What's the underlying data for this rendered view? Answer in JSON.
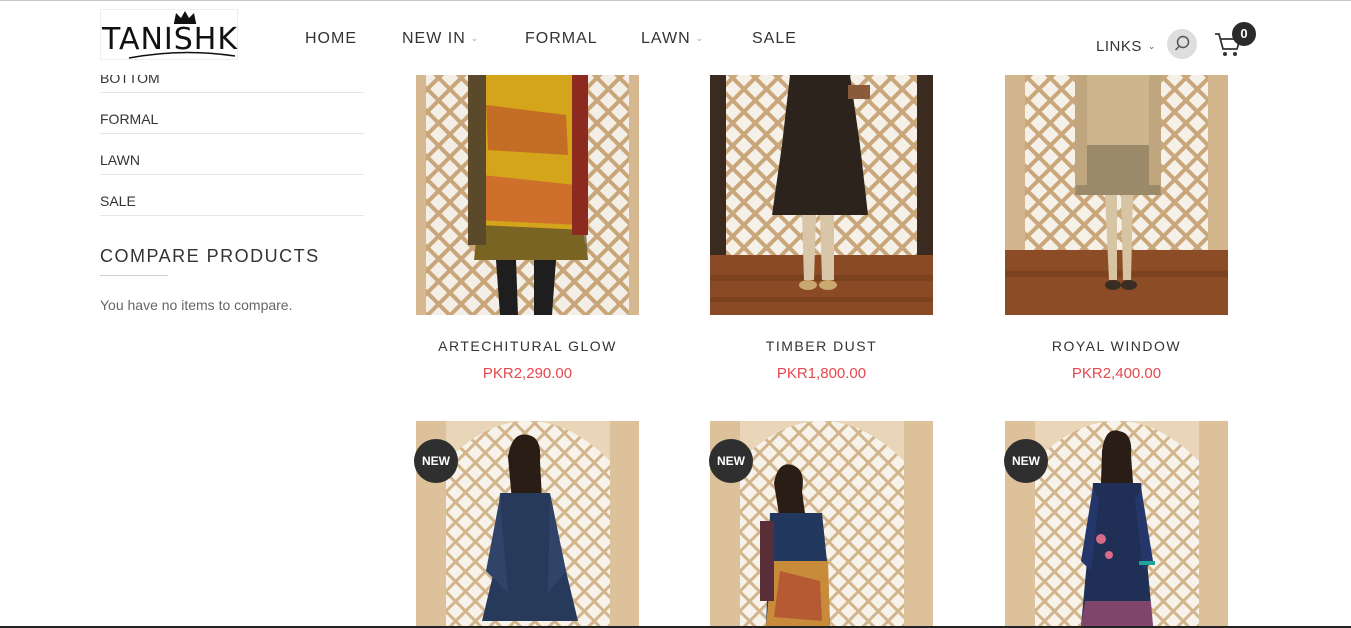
{
  "brand": {
    "logo_text": "TANISHK"
  },
  "nav": {
    "items": [
      {
        "label": "HOME",
        "has_dropdown": false
      },
      {
        "label": "NEW IN",
        "has_dropdown": true
      },
      {
        "label": "FORMAL",
        "has_dropdown": false
      },
      {
        "label": "LAWN",
        "has_dropdown": true
      },
      {
        "label": "SALE",
        "has_dropdown": false
      }
    ],
    "links_label": "LINKS",
    "search_icon": "search-icon",
    "cart_icon": "cart-icon",
    "cart_count": "0"
  },
  "sidebar": {
    "categories": [
      "BOTTOM",
      "FORMAL",
      "LAWN",
      "SALE"
    ],
    "compare": {
      "title": "COMPARE PRODUCTS",
      "empty_text": "You have no items to compare."
    }
  },
  "products": [
    {
      "name": "ARTECHITURAL GLOW",
      "price": "PKR2,290.00"
    },
    {
      "name": "TIMBER DUST",
      "price": "PKR1,800.00"
    },
    {
      "name": "ROYAL WINDOW",
      "price": "PKR2,400.00"
    },
    {
      "badge": "NEW"
    },
    {
      "badge": "NEW"
    },
    {
      "badge": "NEW"
    }
  ],
  "colors": {
    "price": "#e5484d",
    "badge_bg": "#2f2f2f",
    "text": "#333333"
  }
}
